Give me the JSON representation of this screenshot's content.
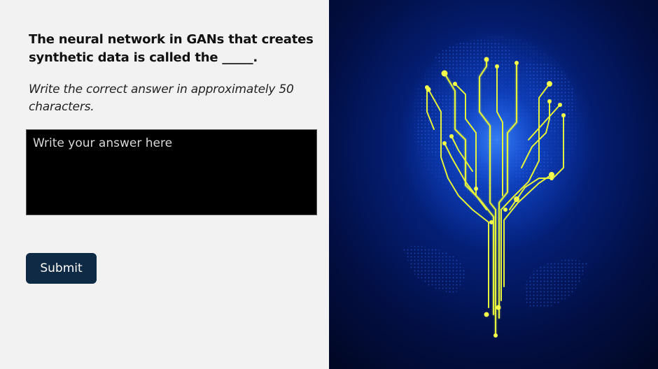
{
  "question": {
    "text": "The neural network in GANs that creates synthetic data is called the _____."
  },
  "instruction": {
    "text": "Write the correct answer in approximately 50 characters."
  },
  "answer": {
    "value": "",
    "placeholder": "Write your answer here"
  },
  "submit": {
    "label": "Submit"
  },
  "illustration": {
    "icon": "circuit-tree-icon",
    "colors": {
      "background": "#010b2e",
      "glow": "#1a5cff",
      "circuit": "#e3f23a",
      "globe": "#1c4fd6"
    }
  }
}
